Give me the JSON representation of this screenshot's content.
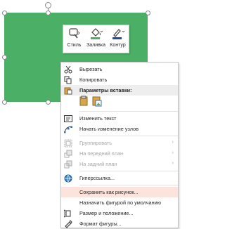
{
  "mini_toolbar": {
    "style_label": "Стиль",
    "fill_label": "Заливка",
    "outline_label": "Контур"
  },
  "colors": {
    "shape_fill": "#4caf66",
    "highlight": "#fce4dc",
    "fill_swatch": "#4caf66",
    "outline_swatch": "#1f4e9a"
  },
  "menu": {
    "cut": "Вырезать",
    "copy": "Копировать",
    "paste_options": "Параметры вставки:",
    "edit_text": "Изменить текст",
    "edit_points": "Начать изменение узлов",
    "group": "Группировать",
    "bring_front": "На передний план",
    "send_back": "На задний план",
    "hyperlink": "Гиперссылка...",
    "save_as_picture": "Сохранить как рисунок...",
    "set_default": "Назначить фигурой по умолчанию",
    "size_position": "Размер и положение...",
    "format_shape": "Формат фигуры..."
  }
}
